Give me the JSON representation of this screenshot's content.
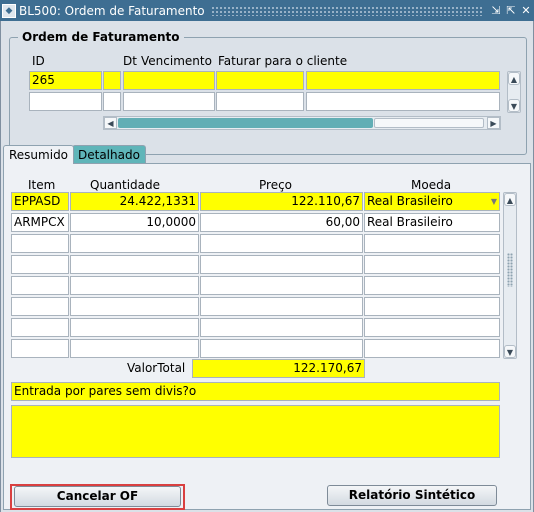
{
  "window": {
    "title": "BL500: Ordem de Faturamento",
    "app_icon": "oracle-forms-icon",
    "controls": [
      "restore-icon",
      "maximize-icon",
      "close-icon"
    ]
  },
  "header": {
    "section_title": "Ordem de Faturamento",
    "labels": {
      "id": "ID",
      "dt": "Dt",
      "vencimento": "Vencimento",
      "faturar": "Faturar para o cliente"
    },
    "rows": [
      {
        "id": "265",
        "dt": "",
        "vencimento": "",
        "faturar": "",
        "client_name": ""
      },
      {
        "id": "",
        "dt": "",
        "vencimento": "",
        "faturar": "",
        "client_name": ""
      }
    ]
  },
  "tabs": [
    {
      "label": "Resumido",
      "active": true
    },
    {
      "label": "Detalhado",
      "active": false
    }
  ],
  "items": {
    "columns": {
      "item": "Item",
      "quantidade": "Quantidade",
      "preco": "Preço",
      "moeda": "Moeda"
    },
    "rows": [
      {
        "item": "EPPASD",
        "quantidade": "24.422,1331",
        "preco": "122.110,67",
        "moeda": "Real Brasileiro"
      },
      {
        "item": "ARMPCX",
        "quantidade": "10,0000",
        "preco": "60,00",
        "moeda": "Real Brasileiro"
      },
      {
        "item": "",
        "quantidade": "",
        "preco": "",
        "moeda": ""
      },
      {
        "item": "",
        "quantidade": "",
        "preco": "",
        "moeda": ""
      },
      {
        "item": "",
        "quantidade": "",
        "preco": "",
        "moeda": ""
      },
      {
        "item": "",
        "quantidade": "",
        "preco": "",
        "moeda": ""
      },
      {
        "item": "",
        "quantidade": "",
        "preco": "",
        "moeda": ""
      },
      {
        "item": "",
        "quantidade": "",
        "preco": "",
        "moeda": ""
      }
    ],
    "total_label": "ValorTotal",
    "total_value": "122.170,67"
  },
  "notes": {
    "line1": "Entrada por pares sem divis?o",
    "line2": ""
  },
  "buttons": {
    "cancel": "Cancelar OF",
    "report": "Relatório Sintético"
  },
  "colors": {
    "required_field": "#ffff00",
    "titlebar": "#3e6e92",
    "tab_inactive": "#5fb5b9",
    "focus": "#d94040"
  }
}
